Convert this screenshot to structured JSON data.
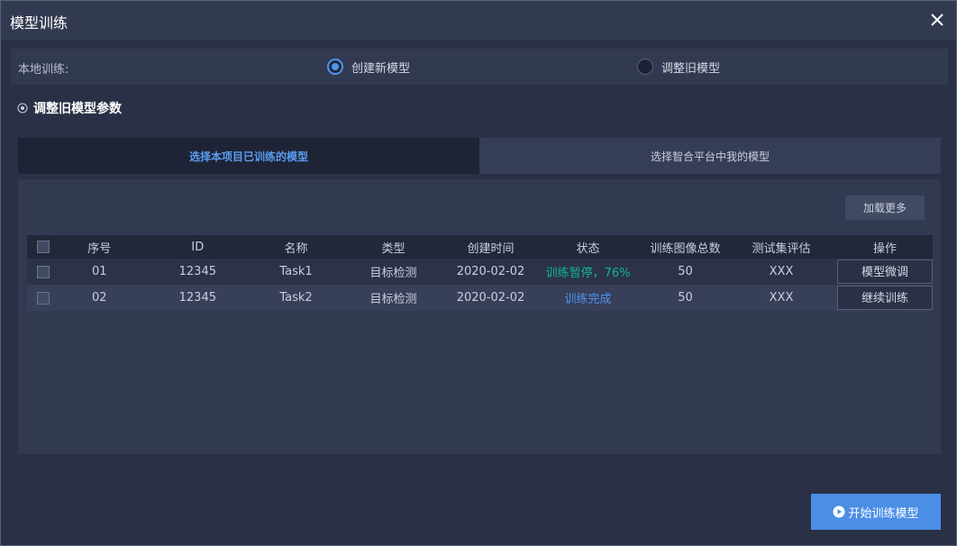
{
  "dialog": {
    "title": "模型训练"
  },
  "local": {
    "label": "本地训练:",
    "options": [
      {
        "label": "创建新模型",
        "selected": true
      },
      {
        "label": "调整旧模型",
        "selected": false
      }
    ]
  },
  "section": {
    "title": "调整旧模型参数"
  },
  "tabs": [
    {
      "label": "选择本项目已训练的模型",
      "active": true
    },
    {
      "label": "选择智合平台中我的模型",
      "active": false
    }
  ],
  "panel": {
    "load_more": "加载更多"
  },
  "table": {
    "headers": [
      "序号",
      "ID",
      "名称",
      "类型",
      "创建时间",
      "状态",
      "训练图像总数",
      "测试集评估",
      "操作"
    ],
    "rows": [
      {
        "index": "01",
        "id": "12345",
        "name": "Task1",
        "type": "目标检测",
        "created": "2020-02-02",
        "status": "训练暂停，76%",
        "images": "50",
        "eval": "XXX",
        "action": "模型微调"
      },
      {
        "index": "02",
        "id": "12345",
        "name": "Task2",
        "type": "目标检测",
        "created": "2020-02-02",
        "status": "训练完成",
        "images": "50",
        "eval": "XXX",
        "action": "继续训练"
      }
    ]
  },
  "footer": {
    "start": "开始训练模型"
  },
  "colors": {
    "accent": "#4f95ef",
    "paused": "#14b39b",
    "done": "#4f95ef",
    "background": "#2a3146"
  }
}
